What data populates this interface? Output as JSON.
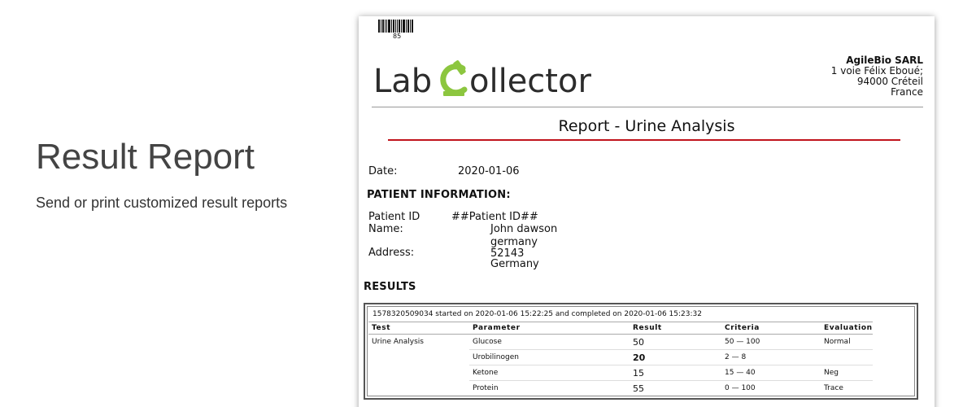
{
  "intro": {
    "title": "Result Report",
    "subtitle": "Send or print customized result reports"
  },
  "report": {
    "barcode_number": "85",
    "logo": {
      "part1": "Lab",
      "part2": "ollector",
      "accent_color": "#8cc63f"
    },
    "company": {
      "name": "AgileBio SARL",
      "street": "1 voie Félix Eboué;",
      "city": "94000 Créteil",
      "country": "France"
    },
    "title": "Report - Urine Analysis",
    "date_label": "Date:",
    "date_value": "2020-01-06",
    "patient_section_label": "PATIENT INFORMATION:",
    "patient": {
      "id_label": "Patient ID",
      "id_value": "##Patient ID##",
      "name_label": "Name:",
      "name_value": "John dawson",
      "address_label": "Address:",
      "address_lines": [
        "germany",
        "52143",
        "Germany"
      ]
    },
    "results_section_label": "RESULTS",
    "results": {
      "run_info": "1578320509034 started on 2020-01-06 15:22:25 and completed on 2020-01-06 15:23:32",
      "columns": [
        "Test",
        "Parameter",
        "Result",
        "Criteria",
        "Evaluation"
      ],
      "test_name": "Urine Analysis",
      "rows": [
        {
          "parameter": "Glucose",
          "result": "50",
          "criteria": "50 — 100",
          "evaluation": "Normal"
        },
        {
          "parameter": "Urobilinogen",
          "result": "20",
          "criteria": "2 — 8",
          "evaluation": ""
        },
        {
          "parameter": "Ketone",
          "result": "15",
          "criteria": "15 — 40",
          "evaluation": "Neg"
        },
        {
          "parameter": "Protein",
          "result": "55",
          "criteria": "0 — 100",
          "evaluation": "Trace"
        }
      ]
    }
  }
}
